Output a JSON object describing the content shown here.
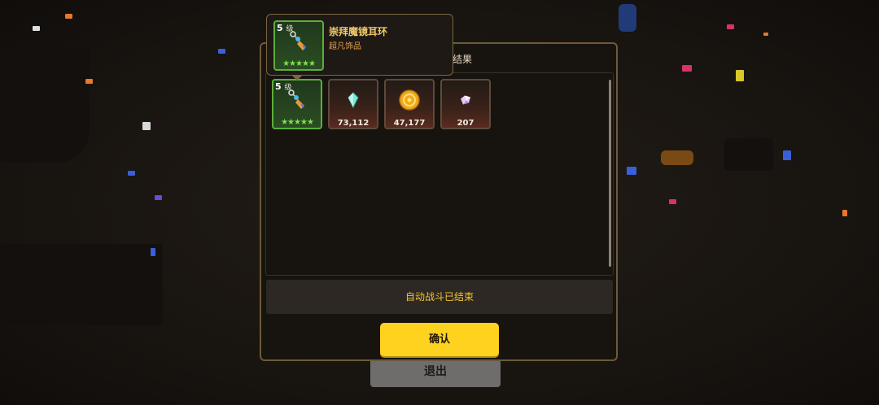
{
  "panel": {
    "title_fragment": "结果",
    "status_text": "自动战斗已结束",
    "confirm_label": "确认"
  },
  "exit_label": "退出",
  "tooltip": {
    "level": "5",
    "level_unit": "级",
    "name": "崇拜魔镜耳环",
    "type": "超凡饰品",
    "stars": "★★★★★"
  },
  "rewards": [
    {
      "kind": "earring",
      "level": "5",
      "level_unit": "级",
      "stars": "★★★★★",
      "icon": "earring-icon"
    },
    {
      "kind": "crystal",
      "quantity": "73,112",
      "icon": "blue-crystal-icon"
    },
    {
      "kind": "coin",
      "quantity": "47,177",
      "icon": "gold-coin-icon"
    },
    {
      "kind": "gem",
      "quantity": "207",
      "icon": "pink-gem-icon"
    }
  ],
  "colors": {
    "accent_yellow": "#ffd21f",
    "status_text": "#f1c52e",
    "rare_border": "#5cae3a",
    "star_green": "#7fe04a"
  }
}
